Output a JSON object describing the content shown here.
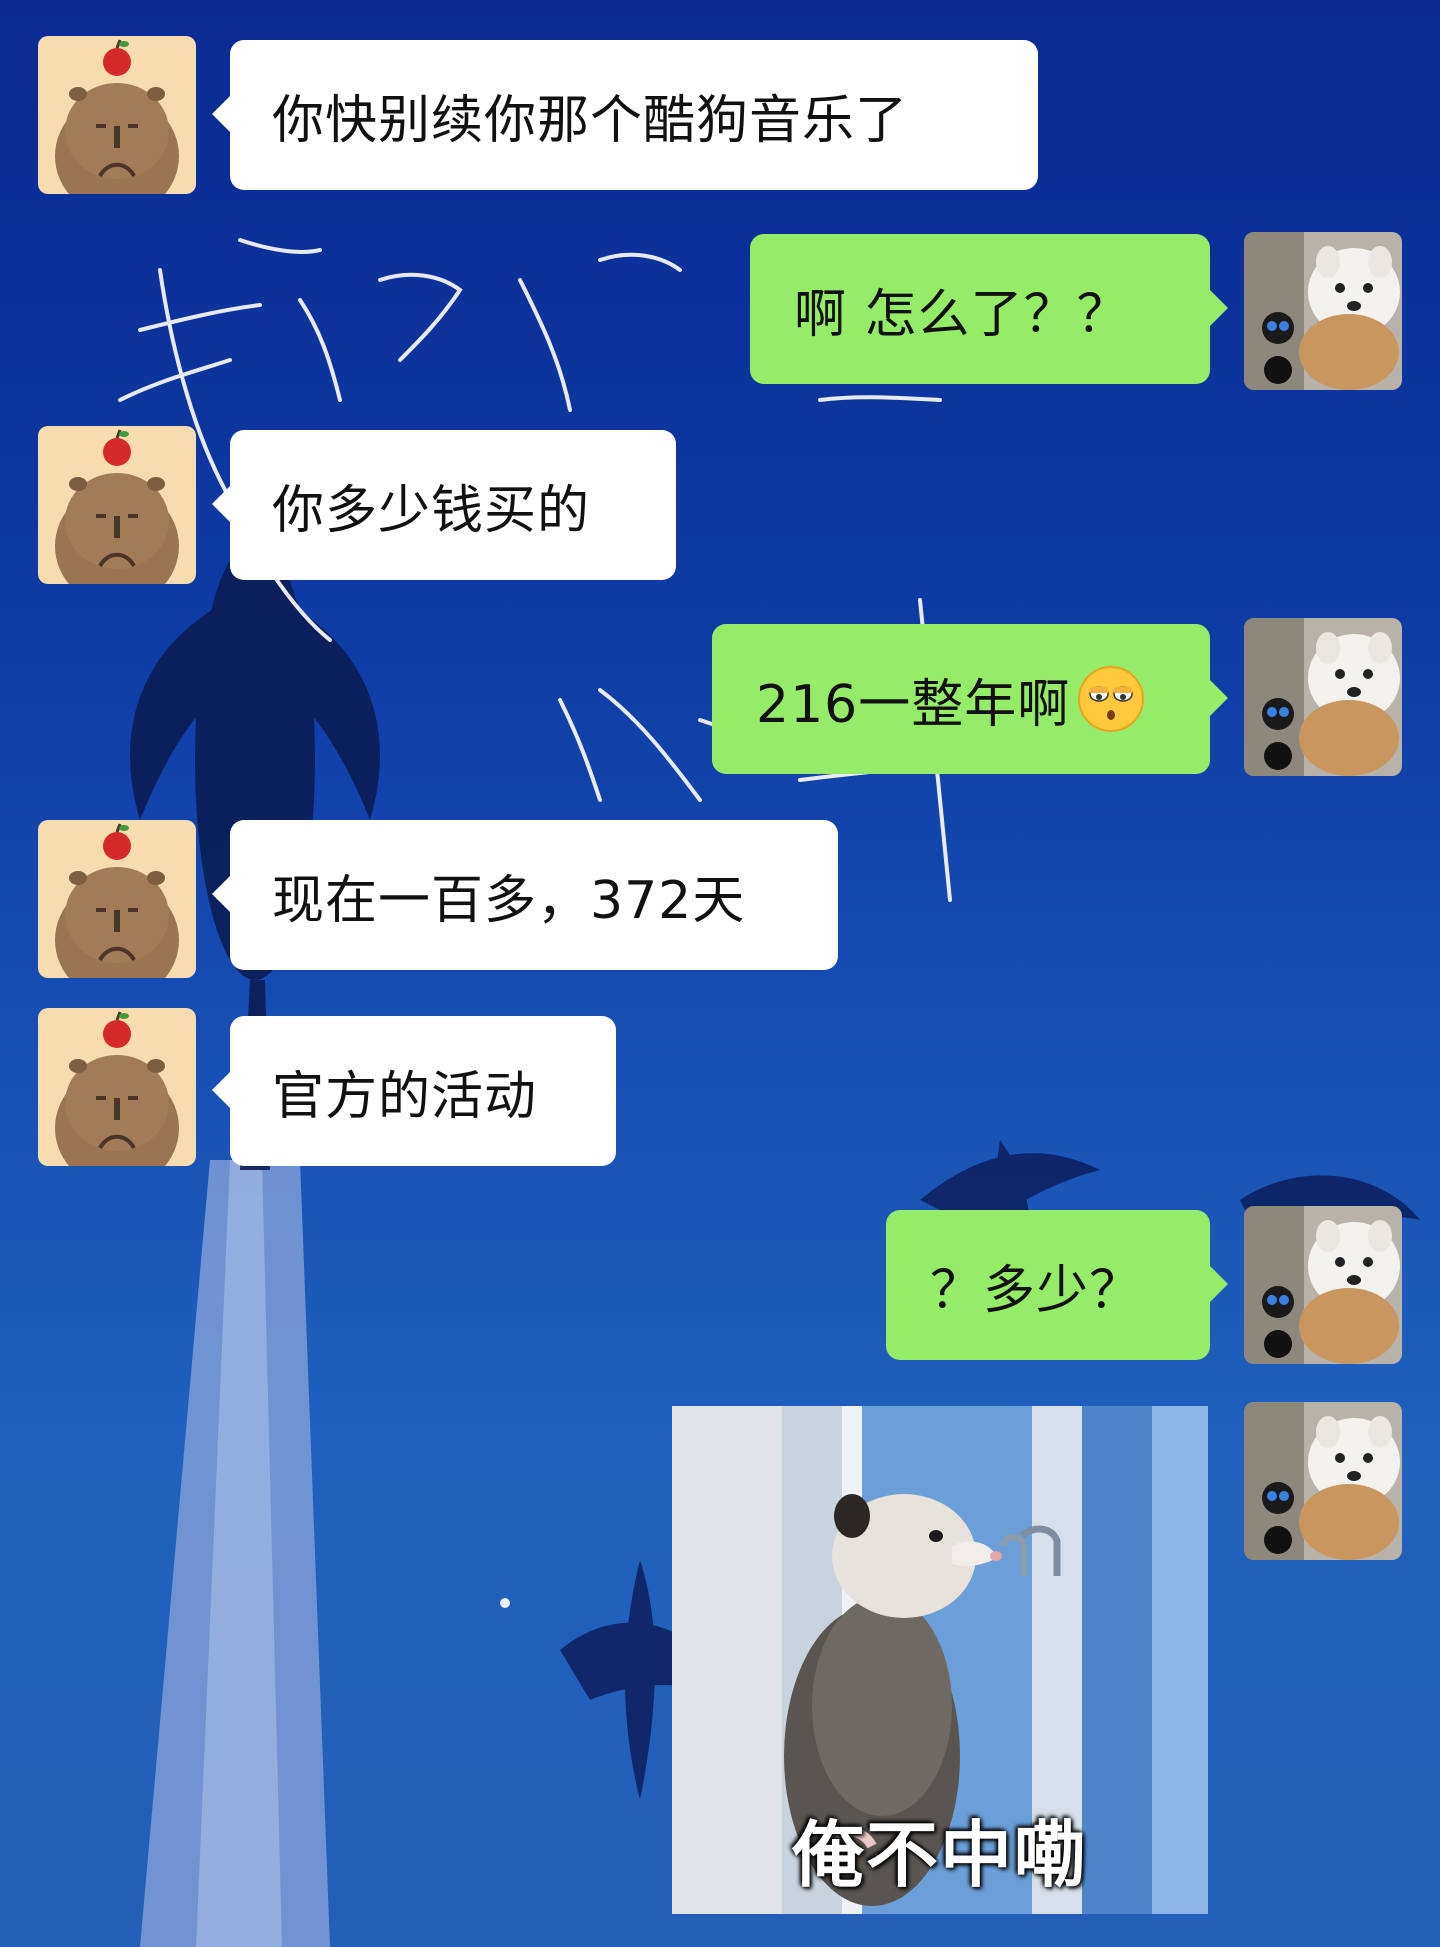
{
  "chat": {
    "messages": [
      {
        "side": "in",
        "text": "你快别续你那个酷狗音乐了"
      },
      {
        "side": "out",
        "text": "啊 怎么了？？"
      },
      {
        "side": "in",
        "text": "你多少钱买的"
      },
      {
        "side": "out",
        "text": "216一整年啊",
        "emoji": "rolling-eyes-emoji"
      },
      {
        "side": "in",
        "text": "现在一百多，372天"
      },
      {
        "side": "in",
        "text": "官方的活动"
      },
      {
        "side": "out",
        "text": "？多少？"
      },
      {
        "side": "out",
        "type": "sticker",
        "caption": "俺不中嘞"
      }
    ]
  },
  "contacts": {
    "them_avatar": "capybara-with-apple-avatar",
    "me_avatar": "white-dog-avatar"
  },
  "colors": {
    "incoming_bubble": "#ffffff",
    "outgoing_bubble": "#95ec69",
    "background": "#0d3aa3"
  }
}
